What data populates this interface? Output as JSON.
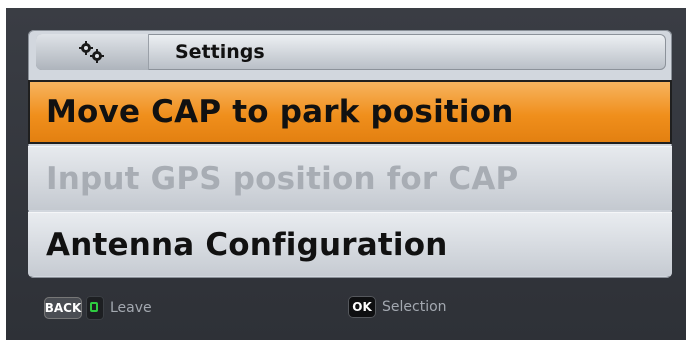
{
  "header": {
    "title": "Settings",
    "icon": "gears-icon"
  },
  "menu": {
    "items": [
      {
        "label": "Move CAP to park position",
        "state": "selected"
      },
      {
        "label": "Input GPS position for CAP",
        "state": "disabled"
      },
      {
        "label": "Antenna Configuration",
        "state": "normal"
      }
    ]
  },
  "footer": {
    "back_key": "BACK",
    "leave_label": "Leave",
    "ok_key": "OK",
    "selection_label": "Selection"
  },
  "colors": {
    "selected_bg": "#f08f1c",
    "panel_bg": "#d2d7de",
    "screen_bg": "#2e3137",
    "disabled_text": "#a8adb4",
    "green_key": "#2ecc40"
  }
}
